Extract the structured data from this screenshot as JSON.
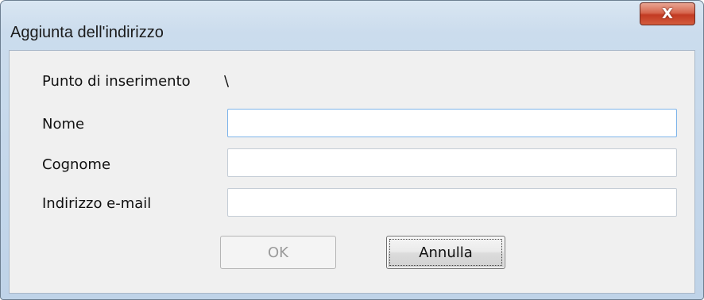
{
  "window": {
    "title": "Aggiunta dell'indirizzo",
    "close_icon": "close-icon",
    "close_glyph": "X"
  },
  "form": {
    "insertion_point_label": "Punto di inserimento",
    "insertion_point_value": "\\",
    "name_label": "Nome",
    "name_value": "",
    "surname_label": "Cognome",
    "surname_value": "",
    "email_label": "Indirizzo e-mail",
    "email_value": ""
  },
  "buttons": {
    "ok_label": "OK",
    "ok_enabled": false,
    "cancel_label": "Annulla"
  },
  "colors": {
    "close_button": "#c8452c",
    "focus_border": "#7eb4ea"
  }
}
